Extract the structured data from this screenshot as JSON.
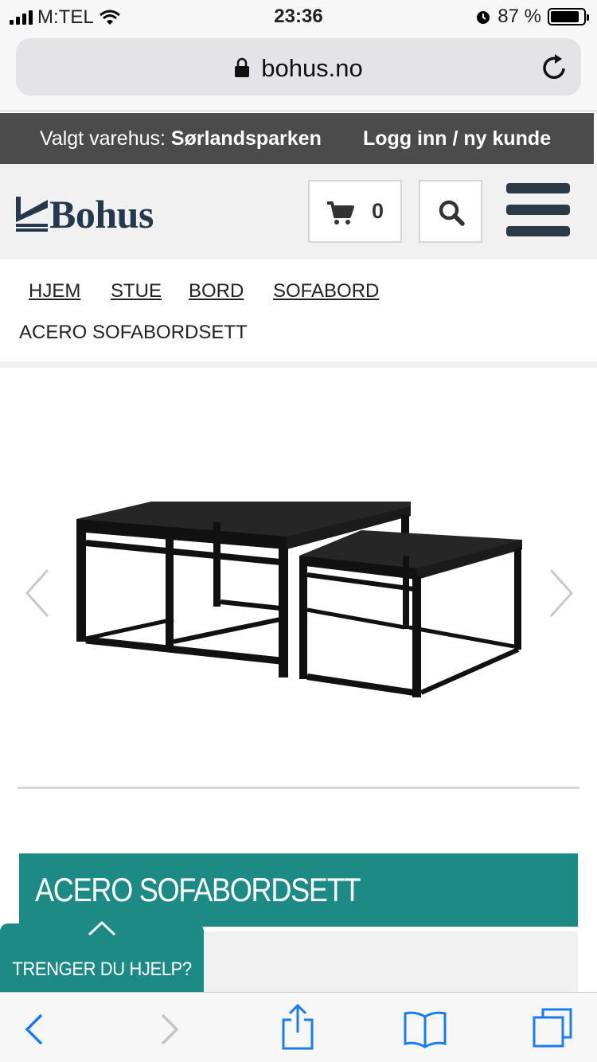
{
  "status_bar": {
    "carrier": "M:TEL",
    "time": "23:36",
    "battery_percent": "87 %",
    "battery_level": 0.87
  },
  "browser": {
    "url": "bohus.no"
  },
  "store_bar": {
    "prefix": "Valgt varehus: ",
    "store_name": "Sørlandsparken",
    "login_label": "Logg inn / ny kunde"
  },
  "header": {
    "logo_text": "Bohus",
    "cart_count": "0"
  },
  "breadcrumb": {
    "items": [
      "HJEM",
      "STUE",
      "BORD",
      "SOFABORD"
    ],
    "current": "ACERO SOFABORDSETT"
  },
  "product": {
    "title": "ACERO SOFABORDSETT"
  },
  "help": {
    "label": "TRENGER DU HJELP?"
  },
  "colors": {
    "accent": "#1e8a86",
    "store_bar_bg": "#4b4b4b",
    "logo": "#243a4c",
    "ios_blue": "#1a7cf5"
  },
  "icons": [
    "lock-icon",
    "reload-icon",
    "cart-icon",
    "search-icon",
    "hamburger-menu-icon",
    "chevron-left-icon",
    "chevron-right-icon",
    "chevron-up-icon",
    "back-icon",
    "forward-icon",
    "share-icon",
    "bookmarks-icon",
    "tabs-icon"
  ]
}
